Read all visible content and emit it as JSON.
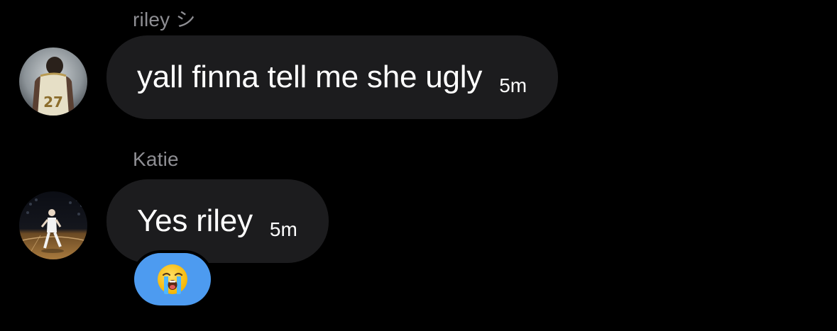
{
  "messages": [
    {
      "sender": "riley シ",
      "text": "yall finna tell me she ugly",
      "time": "5m",
      "avatar": "avatar-riley-basketball-27"
    },
    {
      "sender": "Katie",
      "text": "Yes riley",
      "time": "5m",
      "avatar": "avatar-katie-court",
      "reaction": {
        "emoji": "😭",
        "icon": "loudly-crying-face-icon",
        "color": "#4d9bf0"
      }
    }
  ],
  "colors": {
    "background": "#000000",
    "bubble": "#1c1c1e",
    "sender_name": "#8e8e93",
    "text": "#ffffff",
    "reaction_bg": "#4d9bf0"
  }
}
